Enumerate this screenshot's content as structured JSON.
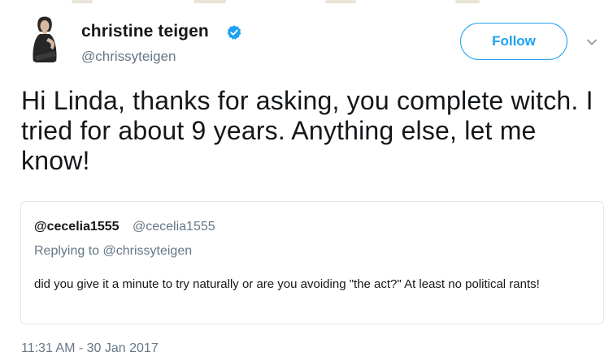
{
  "tweet": {
    "author": {
      "display_name": "christine teigen",
      "handle": "@chrissyteigen",
      "verified": true,
      "avatar_icon": "profile-photo"
    },
    "follow_label": "Follow",
    "text": "Hi Linda, thanks for asking, you complete witch. I tried for about 9 years. Anything else, let me know!",
    "timestamp": "11:31 AM - 30 Jan 2017"
  },
  "quoted_tweet": {
    "display_name": "@cecelia1555",
    "handle": "@cecelia1555",
    "replying_to": "Replying to @chrissyteigen",
    "text": "did you give it a minute to try naturally or are you avoiding \"the act?\" At least no political rants!"
  },
  "colors": {
    "accent": "#1da1f2",
    "text_primary": "#14171a",
    "text_secondary": "#657786",
    "border": "#e1e8ed"
  }
}
